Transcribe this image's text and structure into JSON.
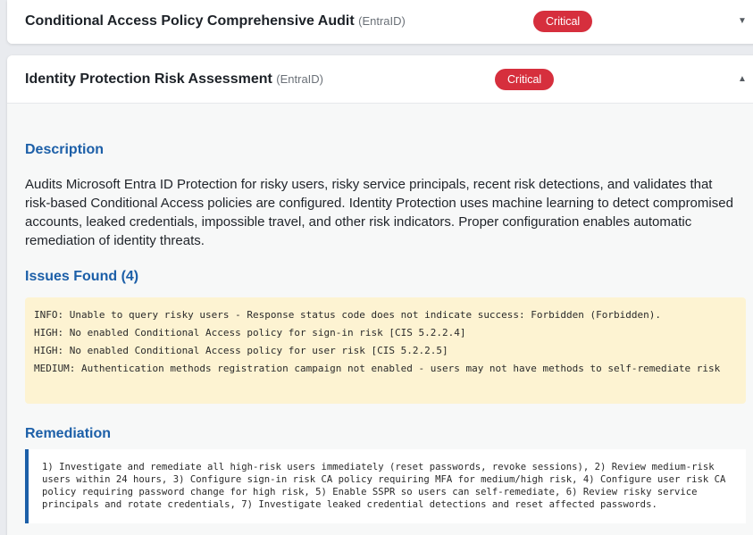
{
  "checks": [
    {
      "title": "Conditional Access Policy Comprehensive Audit",
      "platform": "(EntraID)",
      "severity": "Critical",
      "toggle_icon": "caret-down-icon"
    },
    {
      "title": "Identity Protection Risk Assessment",
      "platform": "(EntraID)",
      "severity": "Critical",
      "toggle_icon": "caret-up-icon",
      "description_heading": "Description",
      "description": "Audits Microsoft Entra ID Protection for risky users, risky service principals, recent risk detections, and validates that risk-based Conditional Access policies are configured. Identity Protection uses machine learning to detect compromised accounts, leaked credentials, impossible travel, and other risk indicators. Proper configuration enables automatic remediation of identity threats.",
      "issues_heading": "Issues Found (4)",
      "issues": [
        "INFO: Unable to query risky users - Response status code does not indicate success: Forbidden (Forbidden).",
        "HIGH: No enabled Conditional Access policy for sign-in risk [CIS 5.2.2.4]",
        "HIGH: No enabled Conditional Access policy for user risk [CIS 5.2.2.5]",
        "MEDIUM: Authentication methods registration campaign not enabled - users may not have methods to self-remediate risk"
      ],
      "remediation_heading": "Remediation",
      "remediation": "1) Investigate and remediate all high-risk users immediately (reset passwords, revoke sessions), 2) Review medium-risk users within 24 hours, 3) Configure sign-in risk CA policy requiring MFA for medium/high risk, 4) Configure user risk CA policy requiring password change for high risk, 5) Enable SSPR so users can self-remediate, 6) Review risky service principals and rotate credentials, 7) Investigate leaked credential detections and reset affected passwords."
    }
  ],
  "colors": {
    "critical_badge": "#d62f3d",
    "section_heading": "#1c5fa8",
    "issues_background": "#fdf3d2",
    "remediation_border": "#1c5fa8"
  }
}
